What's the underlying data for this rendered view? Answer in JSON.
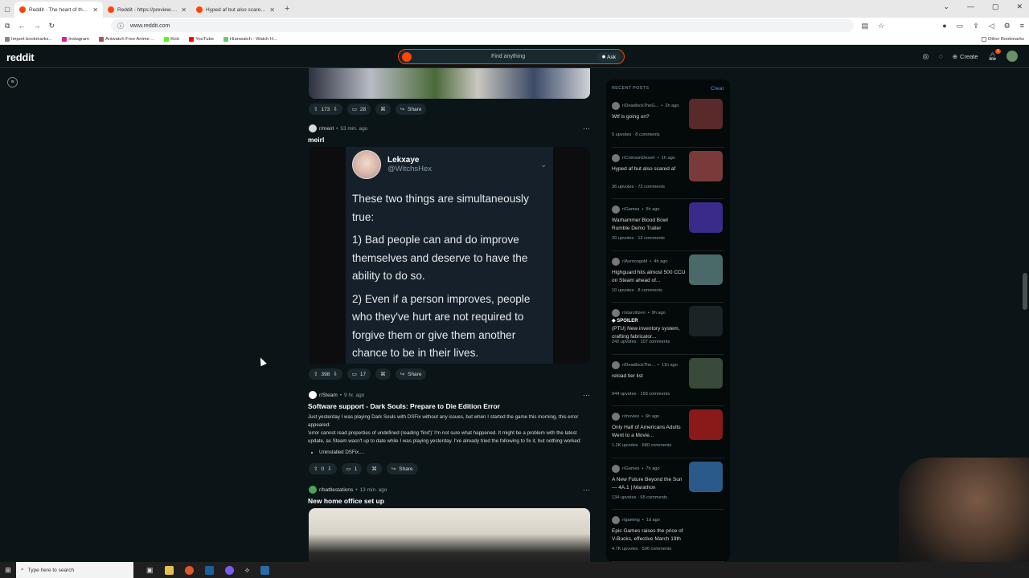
{
  "browser": {
    "tabs": [
      {
        "title": "Reddit - The heart of the intern",
        "active": true
      },
      {
        "title": "Reddit - https://preview.redd.it",
        "active": false
      },
      {
        "title": "Hyped af but also scared af : r/",
        "active": false
      }
    ],
    "url": "www.reddit.com",
    "bookmarks": [
      "Import bookmarks...",
      "Instagram",
      "Aniwatch Free Anime ...",
      "Kick",
      "YouTube",
      "Hianwatch - Watch H..."
    ],
    "other_bookmarks": "Other Bookmarks"
  },
  "header": {
    "logo": "reddit",
    "search_placeholder": "Find anything",
    "ask_label": "Ask",
    "create_label": "Create",
    "notification_count": "1"
  },
  "feed": {
    "post0": {
      "upvotes": "173",
      "comments": "28",
      "share": "Share"
    },
    "post1": {
      "subreddit": "r/meirl",
      "time": "53 min. ago",
      "title": "meirl",
      "tweet_name": "Lekxaye",
      "tweet_handle": "@WitchsHex",
      "tweet_p1": "These two things are simultaneously true:",
      "tweet_p2": "1) Bad people can and do improve themselves and deserve to have the ability to do so.",
      "tweet_p3": "2) Even if a person improves, people who they've hurt are not required to forgive them or give them another chance to be in their lives.",
      "upvotes": "398",
      "comments": "17",
      "share": "Share"
    },
    "post2": {
      "subreddit": "r/Steam",
      "time": "9 hr. ago",
      "title": "Software support - Dark Souls: Prepare to Die Edition Error",
      "body1": "Just yesterday I was playing Dark Souls with DSFix without any issues, but when I started the game this morning, this error appeared:",
      "body2": "'error cannot read properties of undefined (reading 'find')' I'm not sure what happened. It might be a problem with the latest update, as Steam wasn't up to date while I was playing yesterday. I've already tried the following to fix it, but nothing worked:",
      "bullet": "Uninstalled DSFix....",
      "upvotes": "0",
      "comments": "1",
      "share": "Share"
    },
    "post3": {
      "subreddit": "r/battlestations",
      "time": "13 min. ago",
      "title": "New home office set up"
    }
  },
  "sidebar": {
    "heading": "RECENT POSTS",
    "clear": "Clear",
    "posts": [
      {
        "sub": "r/DeadlockTheG...",
        "time": "2h ago",
        "title": "Wtf is going on?",
        "upvotes": "5 upvotes",
        "comments": "8 comments",
        "thumb": "#5a2a2a"
      },
      {
        "sub": "r/CrimsonDesert",
        "time": "1h ago",
        "title": "Hyped af but also scared af",
        "upvotes": "36 upvotes",
        "comments": "72 comments",
        "thumb": "#7a3a3a"
      },
      {
        "sub": "r/Games",
        "time": "5h ago",
        "title": "Warhammer Blood Bowl Rumble Demo Trailer",
        "upvotes": "20 upvotes",
        "comments": "12 comments",
        "thumb": "#3a2a8a"
      },
      {
        "sub": "r/Asmongold",
        "time": "4h ago",
        "title": "Highguard hits almost 500 CCU on Steam ahead of...",
        "upvotes": "10 upvotes",
        "comments": "8 comments",
        "thumb": "#4a6a6a"
      },
      {
        "sub": "r/starcitizen",
        "time": "9h ago",
        "spoiler": "SPOILER",
        "title": "(PTU) New inventory system, crafting fabricator...",
        "upvotes": "242 upvotes",
        "comments": "107 comments",
        "thumb": "#1a2326"
      },
      {
        "sub": "r/DeadlockThe...",
        "time": "11h ago",
        "title": "reload tier list",
        "upvotes": "944 upvotes",
        "comments": "193 comments",
        "thumb": "#3a4a3a"
      },
      {
        "sub": "r/movies",
        "time": "6h ago",
        "title": "Only Half of Americans Adults Went to a Movie...",
        "upvotes": "1.2K upvotes",
        "comments": "680 comments",
        "thumb": "#8a1a1a"
      },
      {
        "sub": "r/Games",
        "time": "7h ago",
        "title": "A New Future Beyond the Sun — 4A.1 | Marathon",
        "upvotes": "134 upvotes",
        "comments": "65 comments",
        "thumb": "#2a5a8a"
      },
      {
        "sub": "r/gaming",
        "time": "1d ago",
        "title": "Epic Games raises the price of V-Bucks, effective March 19th",
        "upvotes": "4.7K upvotes",
        "comments": "506 comments",
        "thumb": "#04090a"
      }
    ]
  },
  "taskbar": {
    "search_placeholder": "Type here to search"
  }
}
